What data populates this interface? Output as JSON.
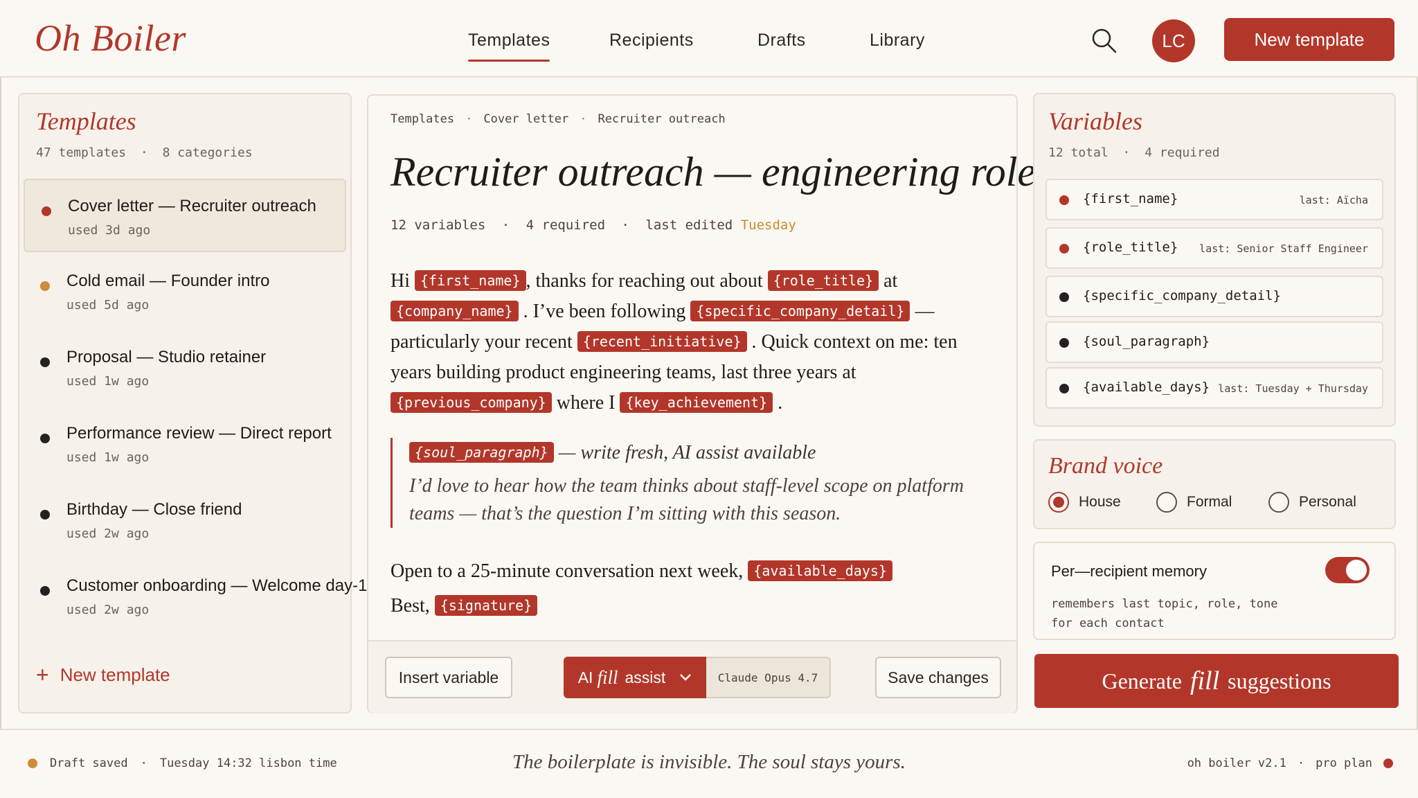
{
  "app": {
    "logo": "Oh Boiler"
  },
  "nav": {
    "items": [
      {
        "label": "Templates",
        "active": true
      },
      {
        "label": "Recipients",
        "active": false
      },
      {
        "label": "Drafts",
        "active": false
      },
      {
        "label": "Library",
        "active": false
      }
    ]
  },
  "header": {
    "search_icon": "search-icon",
    "avatar_initials": "LC",
    "new_template_label": "New template"
  },
  "sidebar": {
    "title": "Templates",
    "count_label": "47 templates",
    "categories_label": "8 categories",
    "sep": "·",
    "items": [
      {
        "title": "Cover letter — Recruiter outreach",
        "used": "used 3d ago",
        "dot_color": "#b2372a",
        "selected": true
      },
      {
        "title": "Cold email — Founder intro",
        "used": "used 5d ago",
        "dot_color": "#d08a3a",
        "selected": false
      },
      {
        "title": "Proposal — Studio retainer",
        "used": "used 1w ago",
        "dot_color": "#222222",
        "selected": false
      },
      {
        "title": "Performance review — Direct report",
        "used": "used 1w ago",
        "dot_color": "#222222",
        "selected": false
      },
      {
        "title": "Birthday — Close friend",
        "used": "used 2w ago",
        "dot_color": "#222222",
        "selected": false
      },
      {
        "title": "Customer onboarding — Welcome day-1",
        "used": "used 2w ago",
        "dot_color": "#222222",
        "selected": false
      }
    ],
    "new_template_plus": "+",
    "new_template_label": "New template"
  },
  "editor": {
    "breadcrumb": [
      "Templates",
      "Cover letter",
      "Recruiter outreach"
    ],
    "breadcrumb_sep": "·",
    "title": "Recruiter outreach — engineering roles",
    "meta": {
      "variables": "12 variables",
      "required": "4 required",
      "edited_prefix": "last edited",
      "edited_day": "Tuesday",
      "sep": "·"
    },
    "body": {
      "t1": "Hi",
      "v1": "{first_name}",
      "t2": ", thanks for reaching out about",
      "v2": "{role_title}",
      "t3": "at",
      "v3": "{company_name}",
      "t4": ". I’ve been following",
      "v4": "{specific_company_detail}",
      "t5": "— particularly your recent",
      "v5": "{recent_initiative}",
      "t6": ". Quick context on me: ten years building product engineering teams, last three years at",
      "v6": "{previous_company}",
      "t7": "where I",
      "v7": "{key_achievement}",
      "t8": "."
    },
    "soul": {
      "variable": "{soul_paragraph}",
      "note": "— write fresh, AI assist available",
      "line1": "I’d love to hear how the team thinks about staff-level scope on platform",
      "line2": "teams — that’s the question I’m sitting with this season."
    },
    "closing": {
      "text": "Open to a 25-minute conversation next week,",
      "days_var": "{available_days}",
      "signoff": "Best,",
      "signature_var": "{signature}"
    },
    "footer": {
      "insert_label": "Insert variable",
      "ai_prefix": "AI",
      "ai_fill": "fill",
      "ai_suffix": "assist",
      "model": "Claude Opus 4.7",
      "save_label": "Save changes"
    }
  },
  "variables": {
    "title": "Variables",
    "total": "12 total",
    "required": "4 required",
    "sep": "·",
    "items": [
      {
        "name": "{first_name}",
        "last": "last: Aïcha",
        "dot_color": "#b2372a"
      },
      {
        "name": "{role_title}",
        "last": "last: Senior Staff Engineer",
        "dot_color": "#b2372a"
      },
      {
        "name": "{specific_company_detail}",
        "last": "",
        "dot_color": "#222222"
      },
      {
        "name": "{soul_paragraph}",
        "last": "",
        "dot_color": "#222222"
      },
      {
        "name": "{available_days}",
        "last": "last: Tuesday + Thursday",
        "dot_color": "#222222"
      }
    ]
  },
  "brand_voice": {
    "title": "Brand voice",
    "options": [
      {
        "label": "House",
        "selected": true
      },
      {
        "label": "Formal",
        "selected": false
      },
      {
        "label": "Personal",
        "selected": false
      }
    ]
  },
  "memory": {
    "title": "Per—recipient memory",
    "description": "remembers last topic, role, tone for each contact",
    "enabled": true
  },
  "generate": {
    "prefix": "Generate",
    "fill": "fill",
    "suffix": "suggestions"
  },
  "footer": {
    "status": "Draft saved",
    "status_dot": "#d08a3a",
    "time": "Tuesday 14:32 lisbon time",
    "sep": "·",
    "tagline": "The boilerplate is invisible. The soul stays yours.",
    "version": "oh boiler v2.1",
    "plan": "pro plan",
    "plan_dot": "#b2372a"
  },
  "colors": {
    "accent": "#b2372a",
    "highlight": "#c98a2e",
    "background": "#fbf8f3",
    "panel": "#f6f2eb"
  }
}
